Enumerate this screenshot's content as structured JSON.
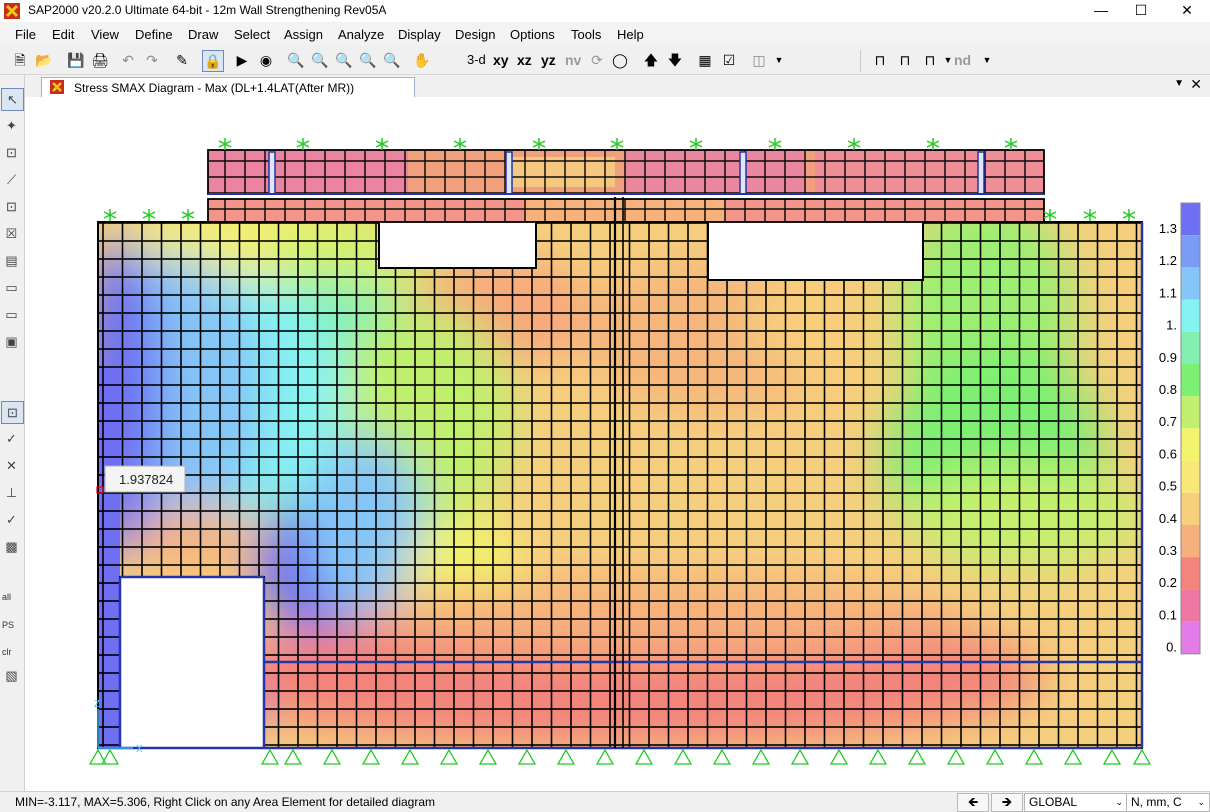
{
  "window": {
    "title": "SAP2000 v20.2.0 Ultimate 64-bit - 12m Wall Strengthening Rev05A"
  },
  "menu": [
    "File",
    "Edit",
    "View",
    "Define",
    "Draw",
    "Select",
    "Assign",
    "Analyze",
    "Display",
    "Design",
    "Options",
    "Tools",
    "Help"
  ],
  "toolbar": {
    "view_3d": "3-d",
    "view_xy": "xy",
    "view_xz": "xz",
    "view_yz": "yz",
    "view_nv": "nv",
    "view_nd": "nd"
  },
  "left_toolbar": {
    "all": "all",
    "ps": "PS",
    "clr": "clr"
  },
  "tab": {
    "title": "Stress SMAX Diagram - Max   (DL+1.4LAT(After MR))"
  },
  "diagram": {
    "tooltip_value": "1.937824",
    "axis_x": "X",
    "axis_z": "Z",
    "legend": {
      "labels": [
        "1.3",
        "1.2",
        "1.1",
        "1.",
        "0.9",
        "0.8",
        "0.7",
        "0.6",
        "0.5",
        "0.4",
        "0.3",
        "0.2",
        "0.1",
        "0."
      ],
      "colors": [
        "#6e6ff2",
        "#7b9cf5",
        "#86c5f7",
        "#86f3f3",
        "#84f0b0",
        "#7def72",
        "#c1f06e",
        "#f3f36e",
        "#f8e878",
        "#f8d07c",
        "#f7b07b",
        "#f3837b",
        "#ef77a2",
        "#e37be8"
      ]
    }
  },
  "status": {
    "text": "MIN=-3.117, MAX=5.306, Right Click on any Area Element for detailed diagram",
    "coord_system": "GLOBAL",
    "units": "N, mm, C"
  }
}
